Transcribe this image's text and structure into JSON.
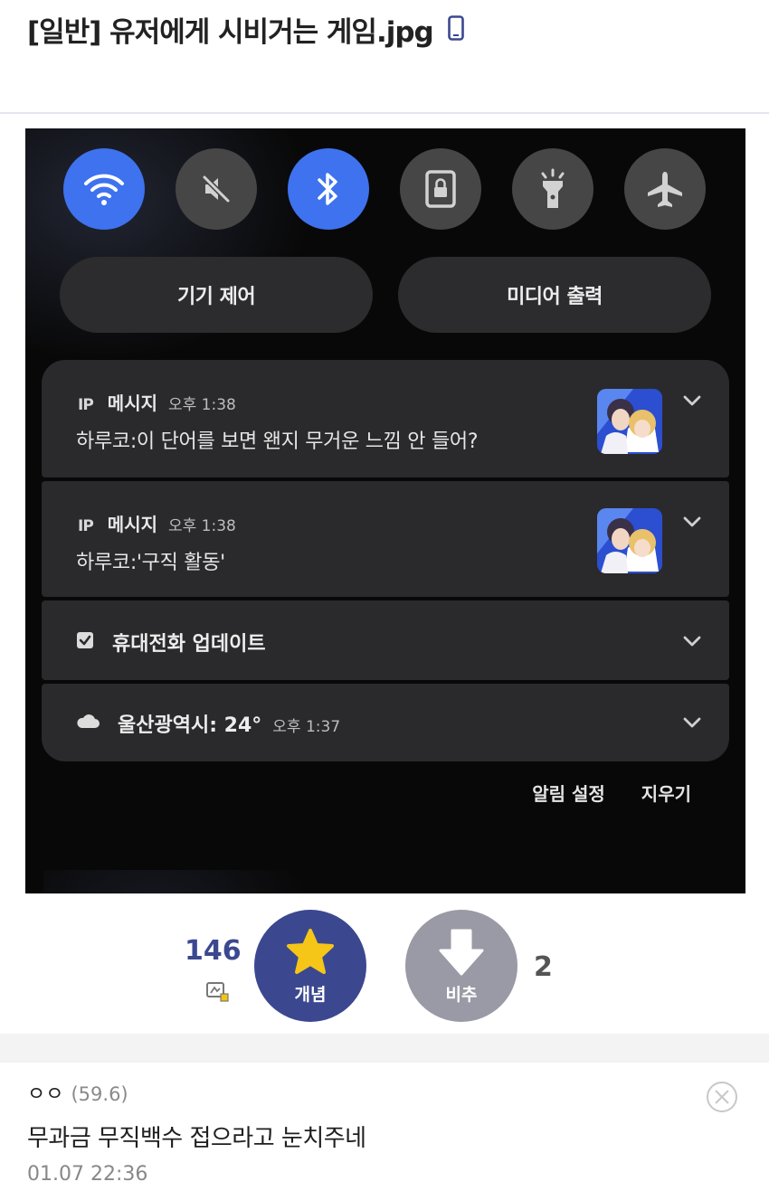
{
  "post": {
    "title": "[일반] 유저에게 시비거는 게임.jpg"
  },
  "phone": {
    "device_control": "기기 제어",
    "media_output": "미디어 출력",
    "notifications": [
      {
        "app_icon_text": "IP",
        "app": "메시지",
        "time": "오후 1:38",
        "body": "하루코:이 단어를 보면 왠지 무거운 느낌 안 들어?"
      },
      {
        "app_icon_text": "IP",
        "app": "메시지",
        "time": "오후 1:38",
        "body": "하루코:'구직 활동'"
      }
    ],
    "update_title": "휴대전화 업데이트",
    "weather_title": "울산광역시: 24°",
    "weather_time": "오후 1:37",
    "notification_settings": "알림 설정",
    "clear": "지우기"
  },
  "votes": {
    "up_count": "146",
    "up_label": "개념",
    "down_label": "비추",
    "down_count": "2",
    "up_color": "#3b4890",
    "down_color": "#9a9aa6"
  },
  "comment": {
    "author": "ㅇㅇ",
    "ip": "(59.6)",
    "text": "무과금 무직백수 접으라고 눈치주네",
    "date": "01.07 22:36"
  }
}
